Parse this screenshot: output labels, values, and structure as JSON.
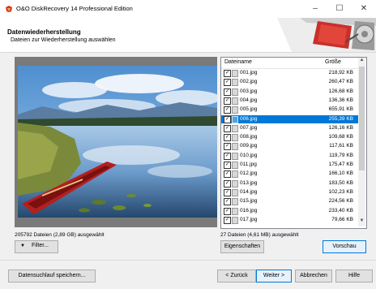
{
  "window": {
    "title": "O&O DiskRecovery 14 Professional Edition"
  },
  "header": {
    "title": "Datenwiederherstellung",
    "subtitle": "Dateien zur Wiederherstellung auswählen"
  },
  "left_panel": {
    "status": "205792 Dateien (2,89 GB) ausgewählt",
    "filter_label": "Filter..."
  },
  "file_list": {
    "col_name": "Dateiname",
    "col_size": "Größe",
    "selected_index": 5,
    "rows": [
      {
        "name": "001.jpg",
        "size": "218,92 KB"
      },
      {
        "name": "002.jpg",
        "size": "260,47 KB"
      },
      {
        "name": "003.jpg",
        "size": "126,68 KB"
      },
      {
        "name": "004.jpg",
        "size": "136,36 KB"
      },
      {
        "name": "005.jpg",
        "size": "655,91 KB"
      },
      {
        "name": "006.jpg",
        "size": "255,39 KB"
      },
      {
        "name": "007.jpg",
        "size": "126,16 KB"
      },
      {
        "name": "008.jpg",
        "size": "109,68 KB"
      },
      {
        "name": "009.jpg",
        "size": "117,61 KB"
      },
      {
        "name": "010.jpg",
        "size": "119,79 KB"
      },
      {
        "name": "011.jpg",
        "size": "175,47 KB"
      },
      {
        "name": "012.jpg",
        "size": "166,10 KB"
      },
      {
        "name": "013.jpg",
        "size": "183,50 KB"
      },
      {
        "name": "014.jpg",
        "size": "102,23 KB"
      },
      {
        "name": "015.jpg",
        "size": "224,56 KB"
      },
      {
        "name": "016.jpg",
        "size": "233,40 KB"
      },
      {
        "name": "017.jpg",
        "size": "79,66 KB"
      }
    ]
  },
  "right_panel": {
    "status": "27 Dateien (4,61 MB) ausgewählt",
    "properties_label": "Eigenschaften",
    "preview_label": "Vorschau"
  },
  "footer": {
    "save_scan_label": "Datensuchlauf speichern...",
    "back_label": "< Zurück",
    "next_label": "Weiter >",
    "cancel_label": "Abbrechen",
    "help_label": "Hilfe"
  },
  "icons": {
    "app": "app-logo-icon",
    "minimize": "minimize-icon",
    "maximize": "maximize-icon",
    "close": "close-icon",
    "file": "image-file-icon",
    "check": "checkbox-checked-icon"
  },
  "colors": {
    "selection": "#0078d7",
    "accent_red": "#d9322b"
  }
}
